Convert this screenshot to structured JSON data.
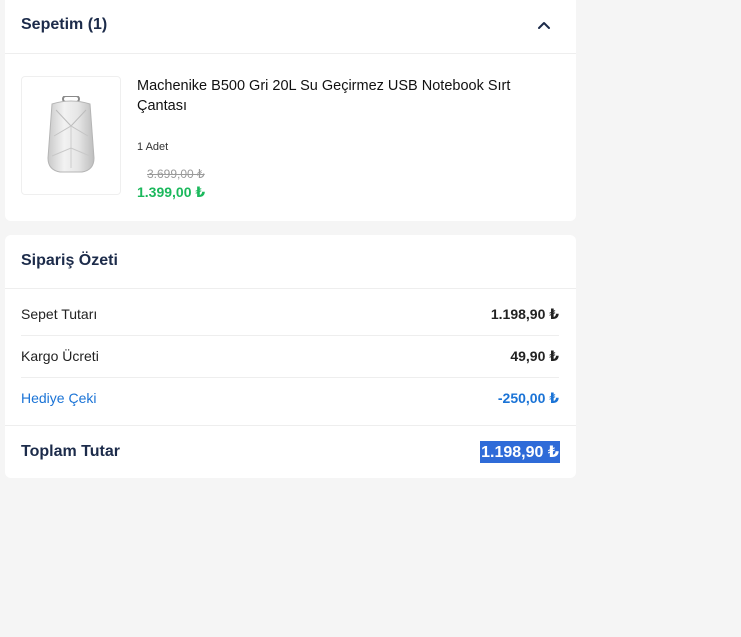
{
  "cart": {
    "title": "Sepetim (1)",
    "toggle_icon": "chevron-up-icon",
    "item": {
      "name": "Machenike B500 Gri 20L Su Geçirmez USB Notebook Sırt Çantası",
      "quantity": "1 Adet",
      "old_price": "3.699,00 ₺",
      "new_price": "1.399,00 ₺",
      "image_icon": "backpack-image"
    }
  },
  "summary": {
    "title": "Sipariş Özeti",
    "rows": [
      {
        "label": "Sepet Tutarı",
        "value": "1.198,90 ₺"
      },
      {
        "label": "Kargo Ücreti",
        "value": "49,90 ₺"
      },
      {
        "label": "Hediye Çeki",
        "value": "-250,00 ₺"
      }
    ],
    "total_label": "Toplam Tutar",
    "total_value": "1.198,90 ₺"
  },
  "colors": {
    "background": "#f5f5f5",
    "heading": "#1c2b4a",
    "price_green": "#1bb85c",
    "gift_blue": "#1a73d6",
    "selection": "#2f6bd8"
  }
}
